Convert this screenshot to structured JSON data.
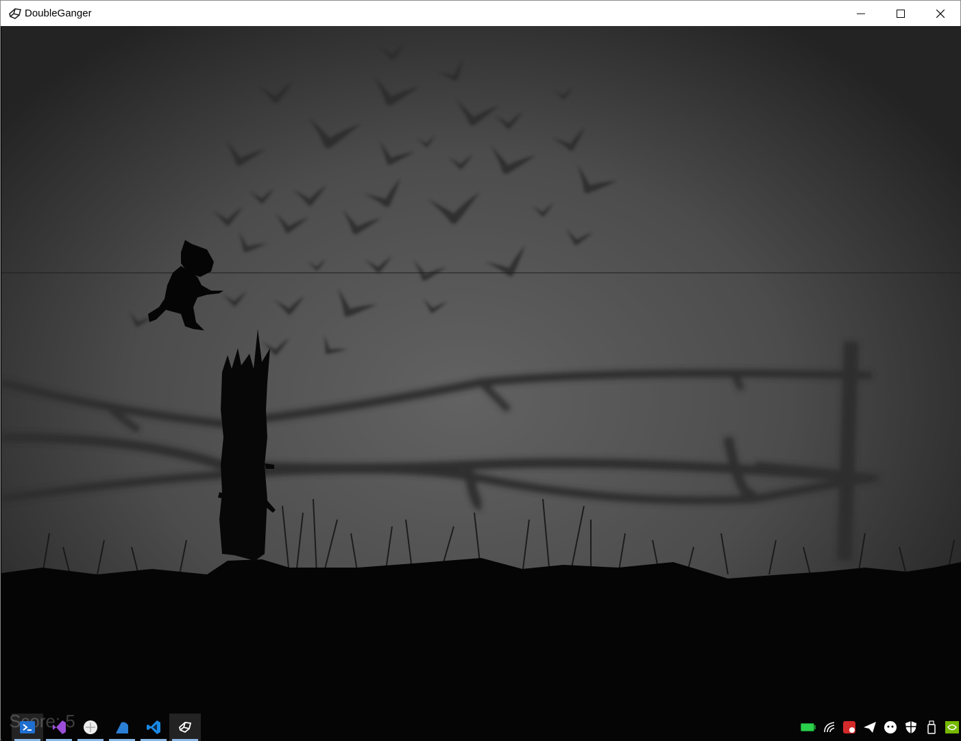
{
  "window": {
    "title": "DoubleGanger"
  },
  "hud": {
    "score_label": "Score: 5"
  },
  "taskbar": {
    "apps": [
      {
        "name": "powershell-icon"
      },
      {
        "name": "visual-studio-icon"
      },
      {
        "name": "media-player-icon"
      },
      {
        "name": "shark-app-icon"
      },
      {
        "name": "vscode-icon"
      },
      {
        "name": "unity-icon"
      }
    ],
    "tray": [
      {
        "name": "battery-icon"
      },
      {
        "name": "wifi-icon"
      },
      {
        "name": "pdf-tray-icon"
      },
      {
        "name": "telegram-icon"
      },
      {
        "name": "chat-tray-icon"
      },
      {
        "name": "defender-shield-icon"
      },
      {
        "name": "usb-drive-icon"
      },
      {
        "name": "nvidia-icon"
      }
    ]
  },
  "colors": {
    "sky_center": "#5e5e5e",
    "sky_edge": "#262626",
    "ground": "#050505",
    "taskbar_accent": "#8cb8e6"
  }
}
